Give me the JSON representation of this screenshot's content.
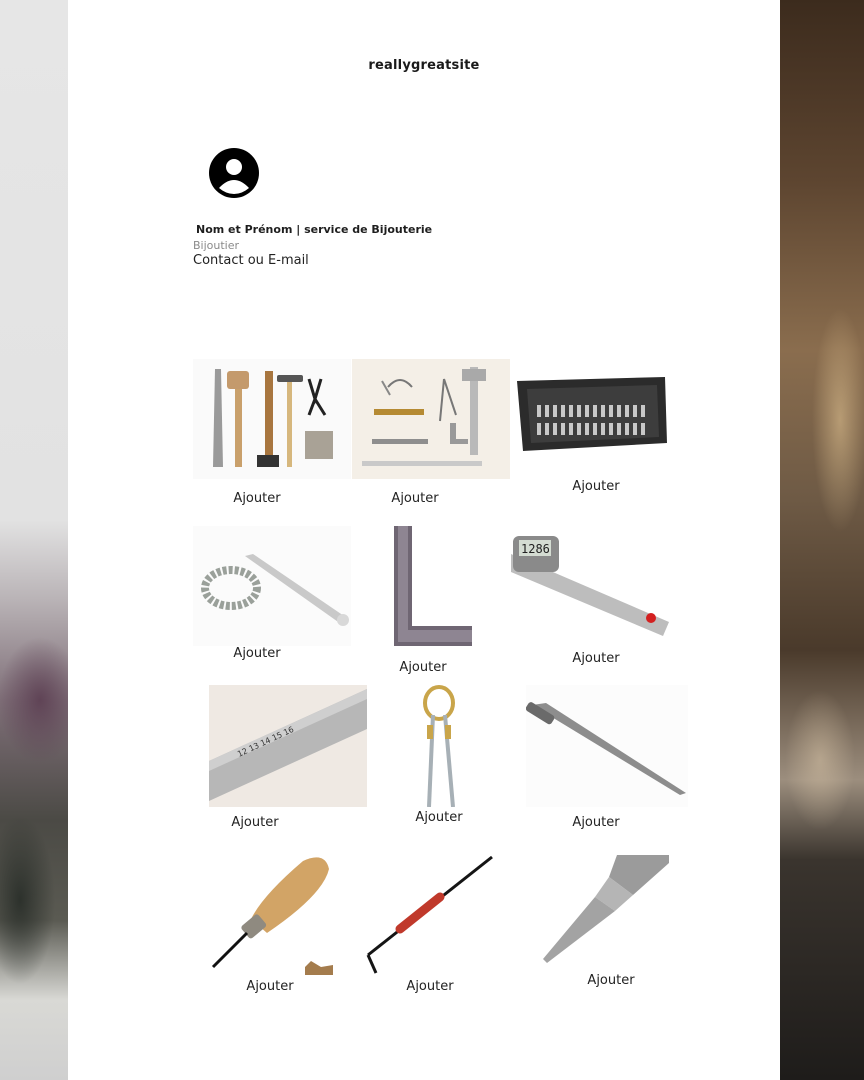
{
  "header": {
    "site_name": "reallygreatsite"
  },
  "profile": {
    "name": "Nom et Prénom | service de Bijouterie",
    "role": "Bijoutier",
    "contact": "Contact ou E-mail",
    "avatar_icon": "user-avatar-icon"
  },
  "products": [
    {
      "image": "jewelry-tool-set",
      "add_label": "Ajouter"
    },
    {
      "image": "measuring-tools-set",
      "add_label": "Ajouter"
    },
    {
      "image": "ring-sizer-case",
      "add_label": "Ajouter"
    },
    {
      "image": "ring-sizer-and-mandrel",
      "add_label": "Ajouter"
    },
    {
      "image": "steel-square",
      "add_label": "Ajouter"
    },
    {
      "image": "digital-caliper",
      "add_label": "Ajouter"
    },
    {
      "image": "steel-ruler",
      "add_label": "Ajouter"
    },
    {
      "image": "soldering-tweezers",
      "add_label": "Ajouter"
    },
    {
      "image": "scriber",
      "add_label": "Ajouter"
    },
    {
      "image": "wooden-handle-tool",
      "add_label": "Ajouter"
    },
    {
      "image": "red-grip-wire-tool",
      "add_label": "Ajouter"
    },
    {
      "image": "automatic-center-punch",
      "add_label": "Ajouter"
    }
  ]
}
